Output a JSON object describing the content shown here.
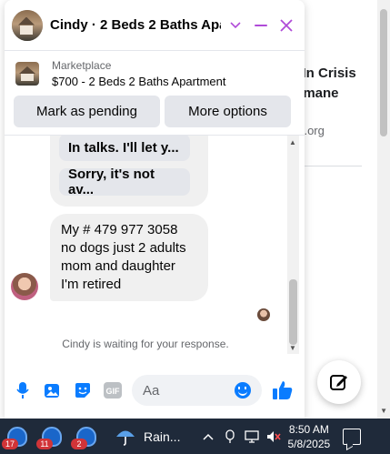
{
  "background_page": {
    "headline_line1": "s In Crisis",
    "headline_line2": "lumane",
    "domain": "ne.org"
  },
  "chat": {
    "title": "Cindy · 2 Beds 2 Baths Apa...",
    "marketplace_label": "Marketplace",
    "listing": "$700 - 2 Beds 2 Baths Apartment",
    "mark_pending_label": "Mark as pending",
    "more_options_label": "More options",
    "reply_chips": [
      "In talks. I'll let y...",
      "Sorry, it's not av..."
    ],
    "message_lines": [
      "My # 479 977 3058",
      "no dogs just 2 adults",
      "mom and daughter",
      "I'm retired"
    ],
    "waiting_text": "Cindy is waiting for your response.",
    "composer_placeholder": "Aa",
    "accent_color": "#b04bd8",
    "composer_icon_color": "#0a7cff"
  },
  "taskbar": {
    "apps": [
      {
        "icon": "app-icon",
        "badge": "17"
      },
      {
        "icon": "app-icon",
        "badge": "11"
      },
      {
        "icon": "app-icon",
        "badge": "2"
      }
    ],
    "weather_label": "Rain...",
    "time": "8:50 AM",
    "date": "5/8/2025"
  }
}
